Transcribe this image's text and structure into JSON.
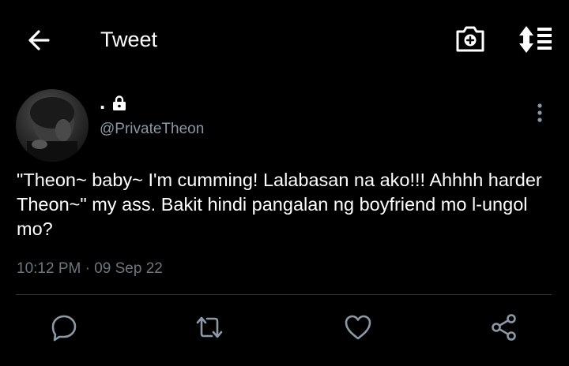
{
  "header": {
    "title": "Tweet",
    "back_icon": "arrow-left-icon",
    "camera_icon": "camera-plus-icon",
    "sort_icon": "sort-arrows-icon"
  },
  "tweet": {
    "display_name": ".",
    "protected_icon": "lock-icon",
    "handle": "@PrivateTheon",
    "text": "\"Theon~ baby~ I'm cumming! Lalabasan na ako!!! Ahhhh harder Theon~\" my ass. Bakit hindi pangalan ng boyfriend mo l-ungol mo?",
    "time": "10:12 PM",
    "separator": "·",
    "date": "09 Sep 22"
  },
  "actions": [
    {
      "name": "reply",
      "icon": "reply-icon"
    },
    {
      "name": "retweet",
      "icon": "retweet-icon"
    },
    {
      "name": "like",
      "icon": "heart-icon"
    },
    {
      "name": "share",
      "icon": "share-icon"
    }
  ],
  "colors": {
    "background": "#000000",
    "text": "#ffffff",
    "secondary_text": "#8b98a5",
    "icon": "#8b98a5",
    "divider": "#2f3336"
  }
}
